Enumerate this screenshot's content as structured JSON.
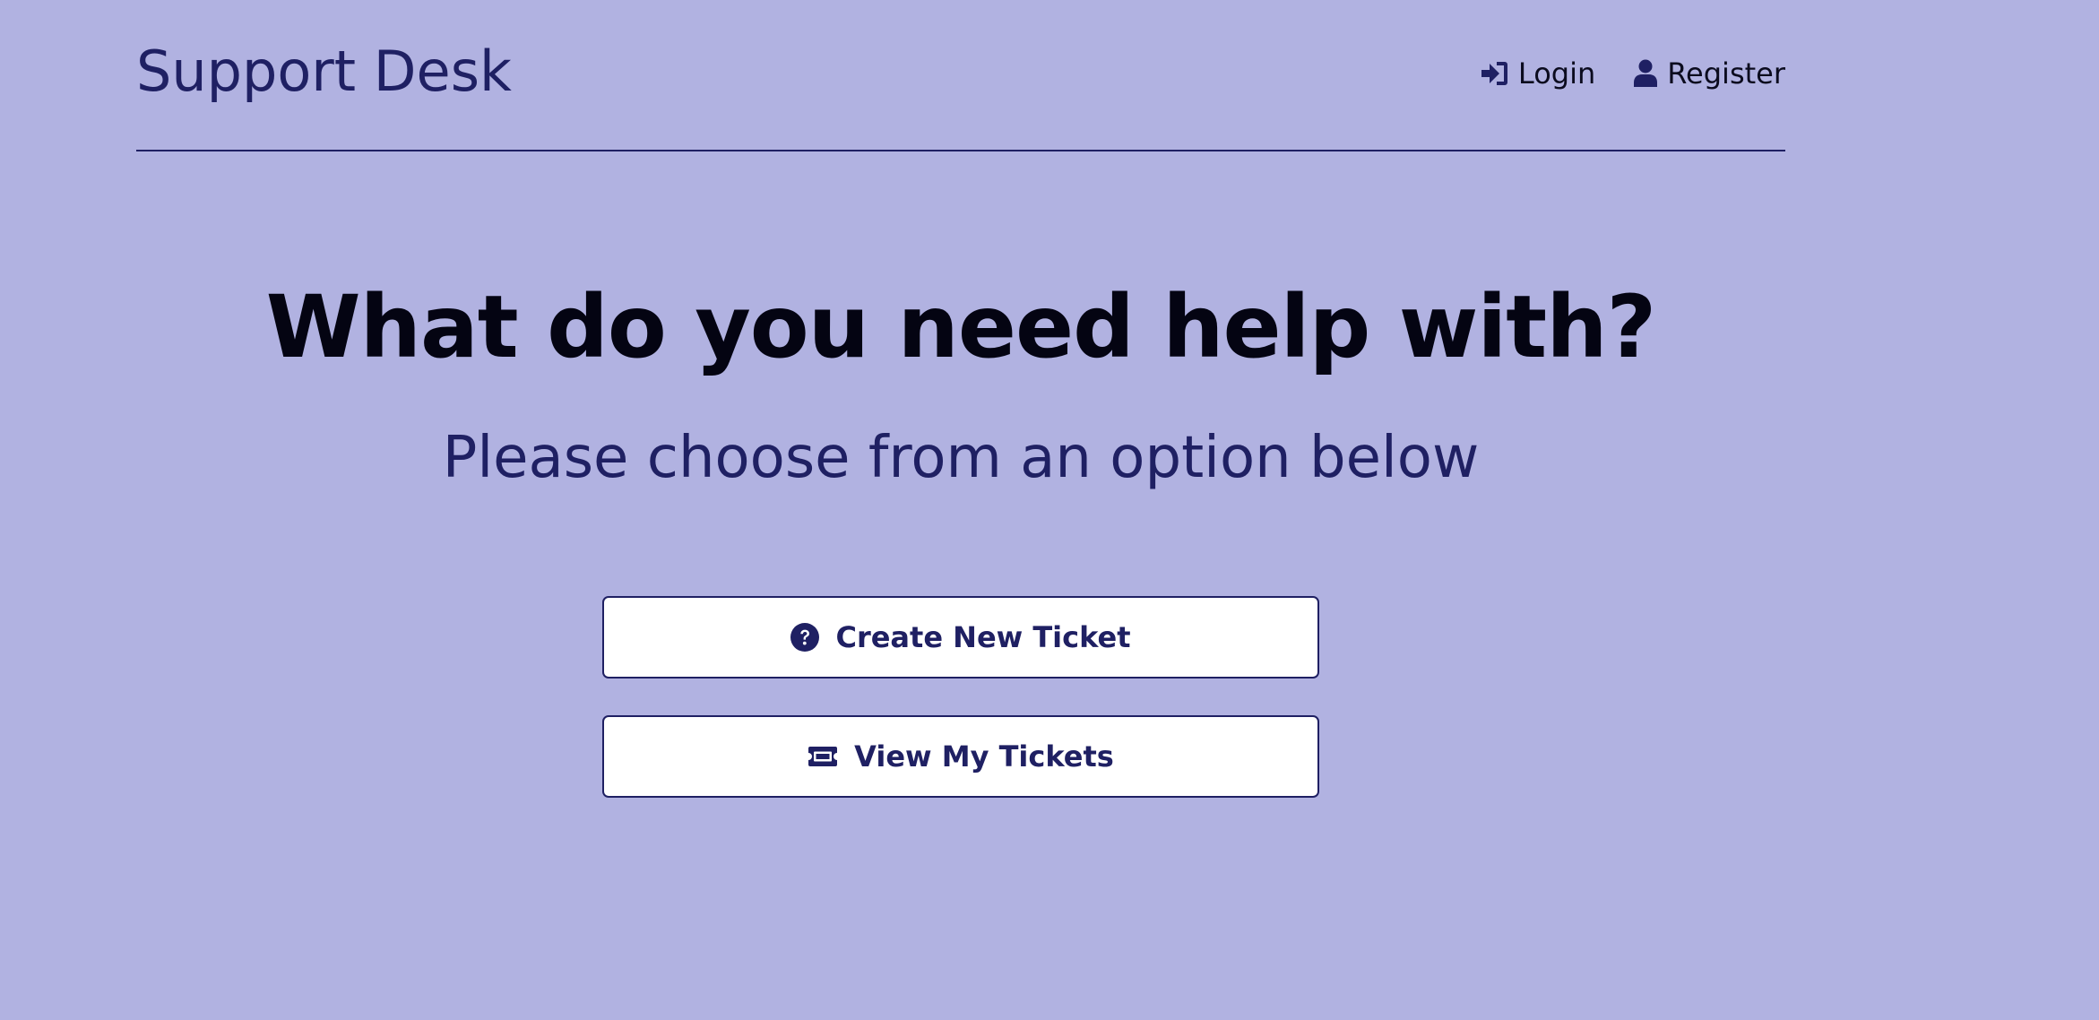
{
  "header": {
    "logo_text": "Support Desk",
    "nav": {
      "login_label": "Login",
      "register_label": "Register"
    }
  },
  "hero": {
    "title": "What do you need help with?",
    "subtitle": "Please choose from an option below"
  },
  "actions": {
    "create_ticket_label": "Create New Ticket",
    "view_tickets_label": "View My Tickets"
  },
  "colors": {
    "background": "#b1b2e1",
    "primary": "#1f2063",
    "button_background": "#ffffff",
    "title_text": "#040412"
  },
  "icons": {
    "login": "sign-in-icon",
    "register": "user-icon",
    "create_ticket": "question-circle-icon",
    "view_tickets": "ticket-icon"
  }
}
